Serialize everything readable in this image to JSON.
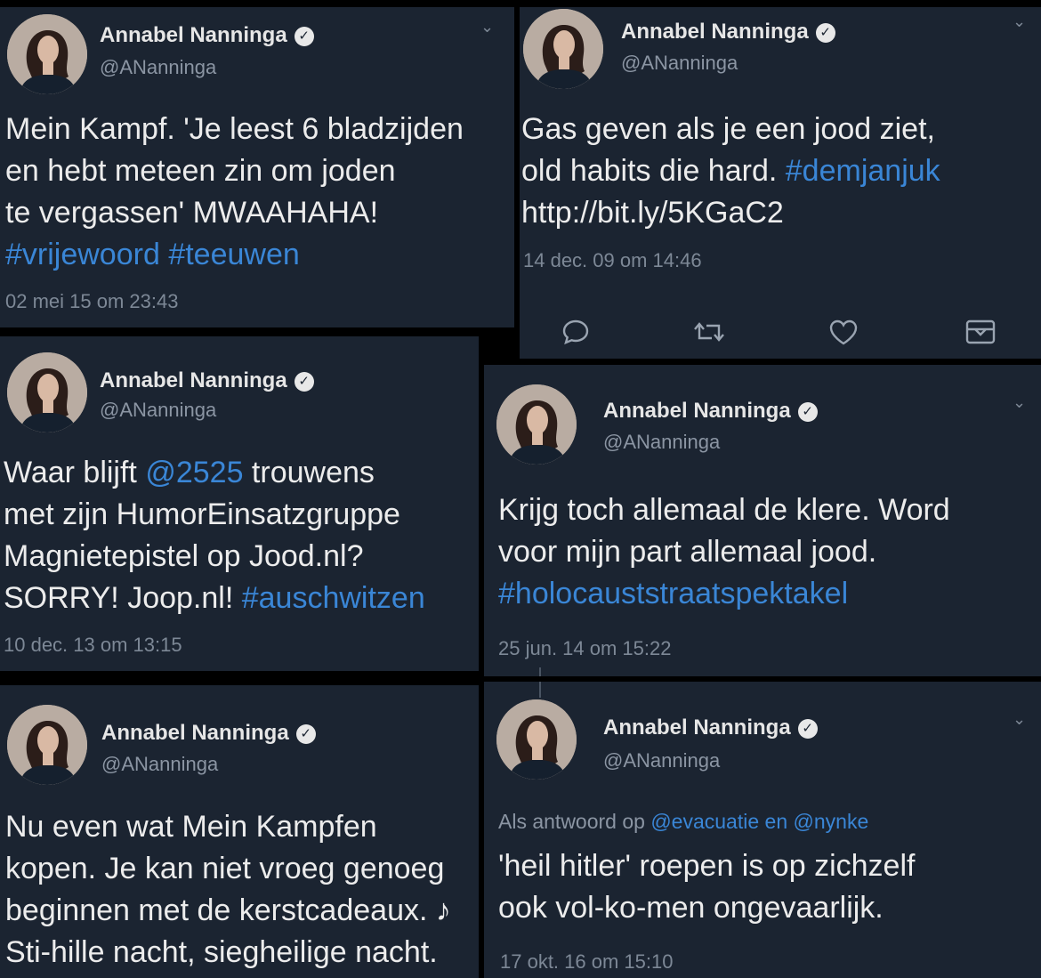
{
  "tweets": [
    {
      "name": "Annabel Nanninga",
      "handle": "@ANanninga",
      "lines": [
        [
          {
            "t": "Mein Kampf. 'Je leest 6 bladzijden"
          }
        ],
        [
          {
            "t": "en hebt meteen zin om joden"
          }
        ],
        [
          {
            "t": "te vergassen' MWAAHAHA!"
          }
        ],
        [
          {
            "t": "#vrijewoord",
            "hl": true
          },
          {
            "t": " "
          },
          {
            "t": "#teeuwen",
            "hl": true
          }
        ]
      ],
      "timestamp": "02 mei 15 om 23:43"
    },
    {
      "name": "Annabel Nanninga",
      "handle": "@ANanninga",
      "lines": [
        [
          {
            "t": "Gas geven als je een jood ziet,"
          }
        ],
        [
          {
            "t": "old habits die hard. "
          },
          {
            "t": "#demjanjuk",
            "hl": true
          }
        ],
        [
          {
            "t": "http://bit.ly/5KGaC2"
          }
        ]
      ],
      "timestamp": "14 dec. 09 om 14:46"
    },
    {
      "name": "Annabel Nanninga",
      "handle": "@ANanninga",
      "lines": [
        [
          {
            "t": "Waar blijft "
          },
          {
            "t": "@2525",
            "hl": true
          },
          {
            "t": " trouwens"
          }
        ],
        [
          {
            "t": "met zijn HumorEinsatzgruppe"
          }
        ],
        [
          {
            "t": "Magnietepistel op Jood.nl?"
          }
        ],
        [
          {
            "t": "SORRY! Joop.nl! "
          },
          {
            "t": "#auschwitzen",
            "hl": true
          }
        ]
      ],
      "timestamp": "10 dec. 13 om 13:15"
    },
    {
      "name": "Annabel Nanninga",
      "handle": "@ANanninga",
      "lines": [
        [
          {
            "t": "Krijg toch allemaal de klere. Word"
          }
        ],
        [
          {
            "t": "voor mijn part allemaal jood."
          }
        ],
        [
          {
            "t": "#holocauststraatspektakel",
            "hl": true
          }
        ]
      ],
      "timestamp": "25 jun. 14 om 15:22"
    },
    {
      "name": "Annabel Nanninga",
      "handle": "@ANanninga",
      "lines": [
        [
          {
            "t": "Nu even wat Mein Kampfen"
          }
        ],
        [
          {
            "t": "kopen. Je kan niet vroeg genoeg"
          }
        ],
        [
          {
            "t": "beginnen met de kerstcadeaux. ♪"
          }
        ],
        [
          {
            "t": "Sti-hille nacht, siegheilige nacht."
          }
        ]
      ],
      "timestamp": ""
    },
    {
      "name": "Annabel Nanninga",
      "handle": "@ANanninga",
      "reply_prefix": "Als antwoord op ",
      "reply_to_1": "@evacuatie",
      "reply_and": " en ",
      "reply_to_2": "@nynke",
      "lines": [
        [
          {
            "t": "'heil hitler' roepen is op zichzelf"
          }
        ],
        [
          {
            "t": "ook vol-ko-men ongevaarlijk."
          }
        ]
      ],
      "timestamp": "17 okt. 16 om 15:10"
    }
  ],
  "verified_glyph": "✓",
  "chevron_glyph": "⌄",
  "icons": [
    "reply-icon",
    "retweet-icon",
    "like-icon",
    "share-icon"
  ],
  "colors": {
    "background": "#1b2431",
    "link": "#3a86d6",
    "muted": "#7d8896"
  }
}
